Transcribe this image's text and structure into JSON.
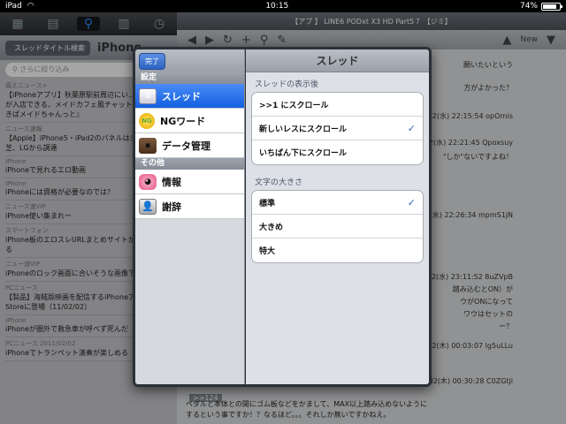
{
  "status": {
    "device": "iPad",
    "time": "10:15",
    "battery": "74%"
  },
  "left": {
    "back_label": "スレッドタイトル検索",
    "title": "iPhone",
    "search_placeholder": "さらに絞り込み",
    "items": [
      {
        "cat": "痛えニュース+",
        "title": "【iPhoneアプリ】秋葉原駅前周辺にい...ある人のみが入店できる、メイドカフェ風チャットアプリ『あきばメイドちゃんっと』"
      },
      {
        "cat": "ニュース速報",
        "title": "【Apple】iPhone5・iPad2のパネルはシャープ、東芝、LGから調達"
      },
      {
        "cat": "iPhone",
        "title": "iPhoneで見れるエロ動画"
      },
      {
        "cat": "iPhone",
        "title": "iPhoneには資格が必要なのでは？"
      },
      {
        "cat": "ニュース速VIP",
        "title": "iPhone使い集まれー"
      },
      {
        "cat": "スマートフォン",
        "title": "iPhone板のエロスレURLまとめサイトが非常に使える"
      },
      {
        "cat": "ニュー速VIP",
        "title": "iPhoneのロック画面に合いそうな画像下さい"
      },
      {
        "cat": "PCニュース",
        "title": "【製品】海賊版映画を配信するiPhoneアプリ、App Storeに登場（11/02/02）"
      },
      {
        "cat": "iPhone",
        "title": "iPhoneが圏外で救急車が呼べず死んだ"
      },
      {
        "cat": "PCニュース",
        "title": "iPhoneでトランペット演奏が楽しめる",
        "date": "2011/02/02"
      }
    ]
  },
  "right": {
    "title": "【アプ 】 LINE6 PODxt X3 HD Part5７ 【ジミ】",
    "new_label": "New",
    "lines": [
      "願いたいという",
      "方がよかった？",
      "02(水) 22:15:54  opOrnis",
      "02(水) 22:21:45  Qpoxsuy",
      "\"しか\"ないですよね！",
      "02(水) 22:26:34  mpmS1jN",
      "02(水) 23:11:52  8uZVpB",
      "踏み込むとON）が",
      "ウがONになって",
      "ワウはセットの",
      "ー？",
      "02(木) 00:03:07  lg5uLLu",
      "02(木) 00:30:28  C0ZGtjl"
    ],
    "quote": ">>124",
    "footer1": "ペダルと本体との間にゴム板などをかまして、MAX以上踏み込めないように",
    "footer2": "するという事ですか！？なるほど。。。それしか無いですかねえ。"
  },
  "popover": {
    "done_label": "完了",
    "settings_header": "設定",
    "other_header": "その他",
    "menu": [
      {
        "label": "スレッド",
        "icon": "thread-list-icon",
        "selected": true
      },
      {
        "label": "NGワード",
        "icon": "ng-face-icon",
        "selected": false
      },
      {
        "label": "データ管理",
        "icon": "briefcase-icon",
        "selected": false
      }
    ],
    "other_menu": [
      {
        "label": "情報",
        "icon": "info-character-icon"
      },
      {
        "label": "謝辞",
        "icon": "person-icon"
      }
    ],
    "content_title": "スレッド",
    "group1_title": "スレッドの表示後",
    "group1_options": [
      {
        "label": ">>1 にスクロール",
        "checked": false
      },
      {
        "label": "新しいレスにスクロール",
        "checked": true
      },
      {
        "label": "いちばん下にスクロール",
        "checked": false
      }
    ],
    "group2_title": "文字の大きさ",
    "group2_options": [
      {
        "label": "標準",
        "checked": true
      },
      {
        "label": "大きめ",
        "checked": false
      },
      {
        "label": "特大",
        "checked": false
      }
    ],
    "check_glyph": "✓"
  }
}
